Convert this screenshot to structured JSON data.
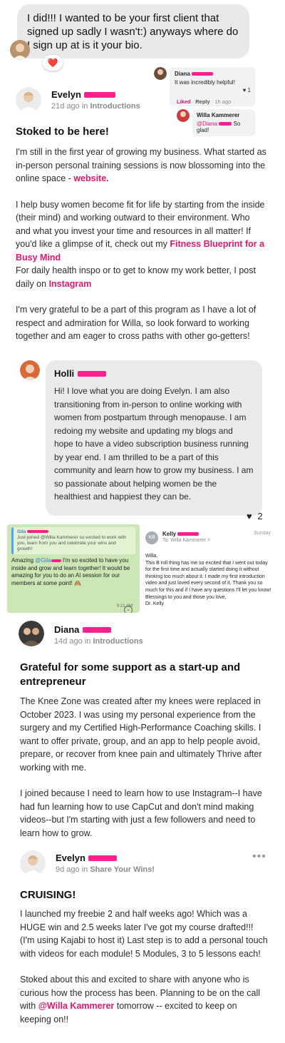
{
  "message": {
    "text": "I did!!! I wanted to be your first client that signed up sadly I wasn't:) anyways where do I sign up at  is it your bio.",
    "reaction": "❤️"
  },
  "mini_comments": {
    "diana": {
      "name": "Diana",
      "text": "It was incredibly helpful!",
      "liked": "Liked",
      "reply": "Reply",
      "time": "1h ago",
      "likes": "1"
    },
    "willa": {
      "name": "Willa Kammerer",
      "mention": "@Diana",
      "text": "So glad!"
    }
  },
  "posts": [
    {
      "author": "Evelyn",
      "time": "21d ago",
      "in": "in",
      "category": "Introductions",
      "title": "Stoked to be here!",
      "p1_a": "I'm still in the first year of growing my business. What started as in-person personal training sessions is now blossoming into the online space - ",
      "p1_link": "website.",
      "p2_a": "I help busy women become fit for life by starting from the inside (their mind) and working outward to their environment. Who and what you invest your time and resources in all matter! If you'd like a glimpse of it, check out my ",
      "p2_link1": "Fitness Blueprint for a Busy Mind",
      "p2_b": "For daily health inspo or to get to know my work better, I post daily on ",
      "p2_link2": "Instagram",
      "p3": "I'm very grateful to be a part of this program as I have a lot of respect and admiration for Willa, so look forward to working together and am eager to cross paths with other go-getters!"
    },
    {
      "author": "Diana",
      "time": "14d ago",
      "in": "in",
      "category": "Introductions",
      "title": "Grateful for some support as a start-up and entrepreneur",
      "p1": "The Knee Zone was created after my knees were replaced in October 2023. I was using my personal experience from the surgery and my Certified High-Performance Coaching skills.  I want to offer private, group, and an app to help people avoid, prepare, or recover from knee pain and ultimately Thrive after working with me.",
      "p2": "I joined because I need to learn how to use Instagram--I have had fun learning how to use CapCut and don't mind making videos--but I'm starting with just a few followers and need to learn how to grow."
    },
    {
      "author": "Evelyn",
      "time": "9d ago",
      "in": "in",
      "category": "Share Your Wins!",
      "title": "CRUISING!",
      "p1": "I launched my freebie 2 and half weeks ago! Which was a HUGE win and 2.5 weeks later I've got my course drafted!!! (I'm using Kajabi to host it) Last step is to add a personal touch with videos for each module! 5 Modules, 3 to 5 lessons each!",
      "p2_a": "Stoked about this and excited to share with anyone who is curious how the process has been. Planning to be on the call with ",
      "p2_mention": "@Willa Kammerer",
      "p2_b": " tomorrow -- excited to keep on keeping on!!"
    }
  ],
  "holli": {
    "name": "Holli",
    "text": "Hi! I love what you are doing Evelyn. I am also transitioning from in-person to online working with women from postpartum through menopause. I am redoing my website and updating my blogs and hope to have a video subscription business running by year end. I am thrilled to be a part of this community and learn how to grow my business. I am so passionate about helping women be the healthiest and happiest they can be.",
    "likes": "2"
  },
  "green_chat": {
    "sender": "Gila",
    "quote": "Just joined @Willa Kammerer so excited to work with you, learn from you and celebrate your wins and growth!",
    "msg_a": "Amazing ",
    "msg_mention": "@Gila",
    "msg_b": " I'm so excited to have you inside and grow and learn together! It would be amazing for you to do an AI session for our members at some point! 🙈",
    "time": "9:21 AM"
  },
  "email": {
    "initials": "KB",
    "sender": "Kelly",
    "to": "To: Willa Kammerer >",
    "day": "Sunday",
    "greeting": "Willa,",
    "body": "This B roll thing has me so excited that I went out today for the first time and actually started doing it without thinking too much about it. I made my first introduction video and just loved every second of it. Thank you so much for this and if I have any questions I'll let you know!",
    "closing": "Blessings to you and those you love,",
    "signature": "Dr. Kelly"
  },
  "colors": {
    "accent": "#e5166e",
    "bubble": "#e9e9eb",
    "chat_green": "#cde6b6"
  },
  "icons": [
    "heart-icon",
    "more-dots-icon",
    "chevron-down-icon"
  ]
}
